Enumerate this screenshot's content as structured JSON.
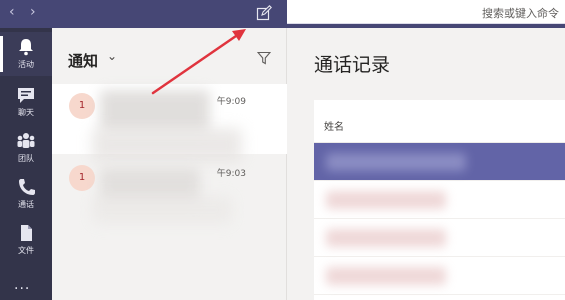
{
  "titlebar": {
    "back_icon": "chevron-left-icon",
    "forward_icon": "chevron-right-icon",
    "compose_icon": "compose-icon",
    "search_placeholder": "搜索或键入命令"
  },
  "rail": {
    "items": [
      {
        "label": "活动",
        "icon": "bell-icon",
        "active": true
      },
      {
        "label": "聊天",
        "icon": "chat-icon",
        "active": false
      },
      {
        "label": "团队",
        "icon": "teams-icon",
        "active": false
      },
      {
        "label": "通话",
        "icon": "phone-icon",
        "active": false
      },
      {
        "label": "文件",
        "icon": "file-icon",
        "active": false
      }
    ],
    "more": "···"
  },
  "notifications": {
    "title": "通知",
    "chevron": "⌄",
    "filter_icon": "filter-icon",
    "items": [
      {
        "badge": "1",
        "time": "午9:09",
        "selected": true
      },
      {
        "badge": "1",
        "time": "午9:03",
        "selected": false
      }
    ]
  },
  "main": {
    "title": "通话记录",
    "column_name": "姓名",
    "rows": 4
  },
  "colors": {
    "titlebar": "#464775",
    "rail": "#33344a",
    "accent": "#6264a7",
    "arrow": "#e0343e"
  }
}
